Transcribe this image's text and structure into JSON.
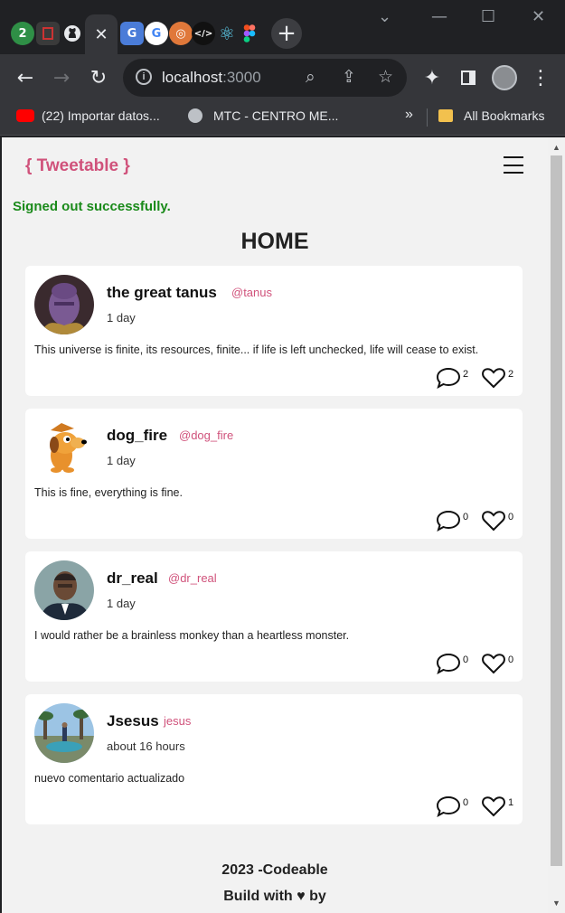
{
  "browser": {
    "url_host": "localhost",
    "url_port": ":3000",
    "bookmarks": [
      {
        "label": "(22) Importar datos..."
      },
      {
        "label": "MTC - CENTRO ME..."
      }
    ],
    "overflow_label": "»",
    "all_bookmarks_label": "All Bookmarks",
    "tab_badge": "2"
  },
  "app": {
    "brand": "{ Tweetable }",
    "flash": "Signed out successfully.",
    "page_title": "HOME",
    "tweets": [
      {
        "name": "the great tanus",
        "handle": "@tanus",
        "time": "1 day",
        "body": "This universe is finite, its resources, finite... if life is left unchecked, life will cease to exist.",
        "comments": "2",
        "likes": "2"
      },
      {
        "name": "dog_fire",
        "handle": "@dog_fire",
        "time": "1 day",
        "body": "This is fine, everything is fine.",
        "comments": "0",
        "likes": "0"
      },
      {
        "name": "dr_real",
        "handle": "@dr_real",
        "time": "1 day",
        "body": "I would rather be a brainless monkey than a heartless monster.",
        "comments": "0",
        "likes": "0"
      },
      {
        "name": "Jsesus",
        "handle": "jesus",
        "time": "about 16 hours",
        "body": "nuevo comentario actualizado",
        "comments": "0",
        "likes": "1"
      }
    ],
    "footer_line1": "2023 -Codeable",
    "footer_line2": "Build with ♥ by"
  },
  "colors": {
    "accent": "#d0527b",
    "flash": "#1a8a1a"
  }
}
